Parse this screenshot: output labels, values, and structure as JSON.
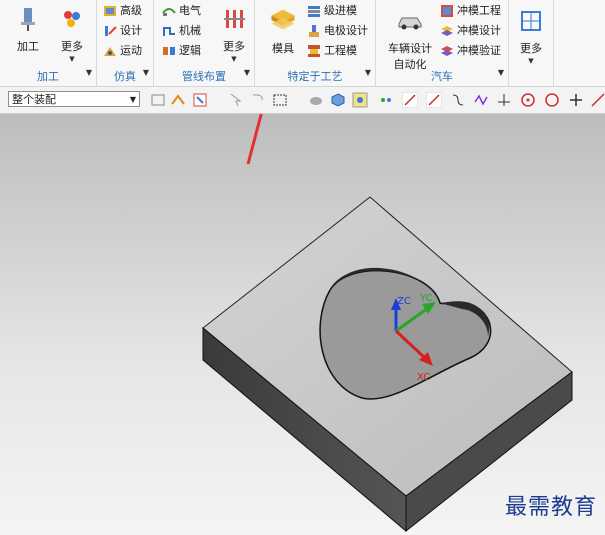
{
  "ribbon": {
    "machining": {
      "btn_label": "加工",
      "more_label": "更多",
      "group_title": "加工"
    },
    "simulation": {
      "items": [
        "高级",
        "设计",
        "运动"
      ],
      "group_title": "仿真"
    },
    "routing": {
      "items": [
        "电气",
        "机械",
        "逻辑"
      ],
      "more_label": "更多",
      "group_title": "管线布置"
    },
    "process": {
      "mold_label": "模具",
      "items": [
        "级进模",
        "电极设计",
        "工程模"
      ],
      "group_title": "特定于工艺"
    },
    "auto": {
      "vehicle_label_line1": "车辆设计",
      "vehicle_label_line2": "自动化",
      "items": [
        "冲模工程",
        "冲模设计",
        "冲模验证"
      ],
      "group_title": "汽车"
    },
    "extra": {
      "more_label": "更多"
    }
  },
  "toolbar": {
    "assembly_filter": "整个装配"
  },
  "viewport": {
    "axis_labels": {
      "z": "ZC",
      "y": "YC",
      "x": "XC"
    },
    "colors": {
      "z": "#1c3fd8",
      "y": "#2aa52a",
      "x": "#d32020",
      "arrow": "#e53030"
    }
  },
  "watermark": "最需教育"
}
